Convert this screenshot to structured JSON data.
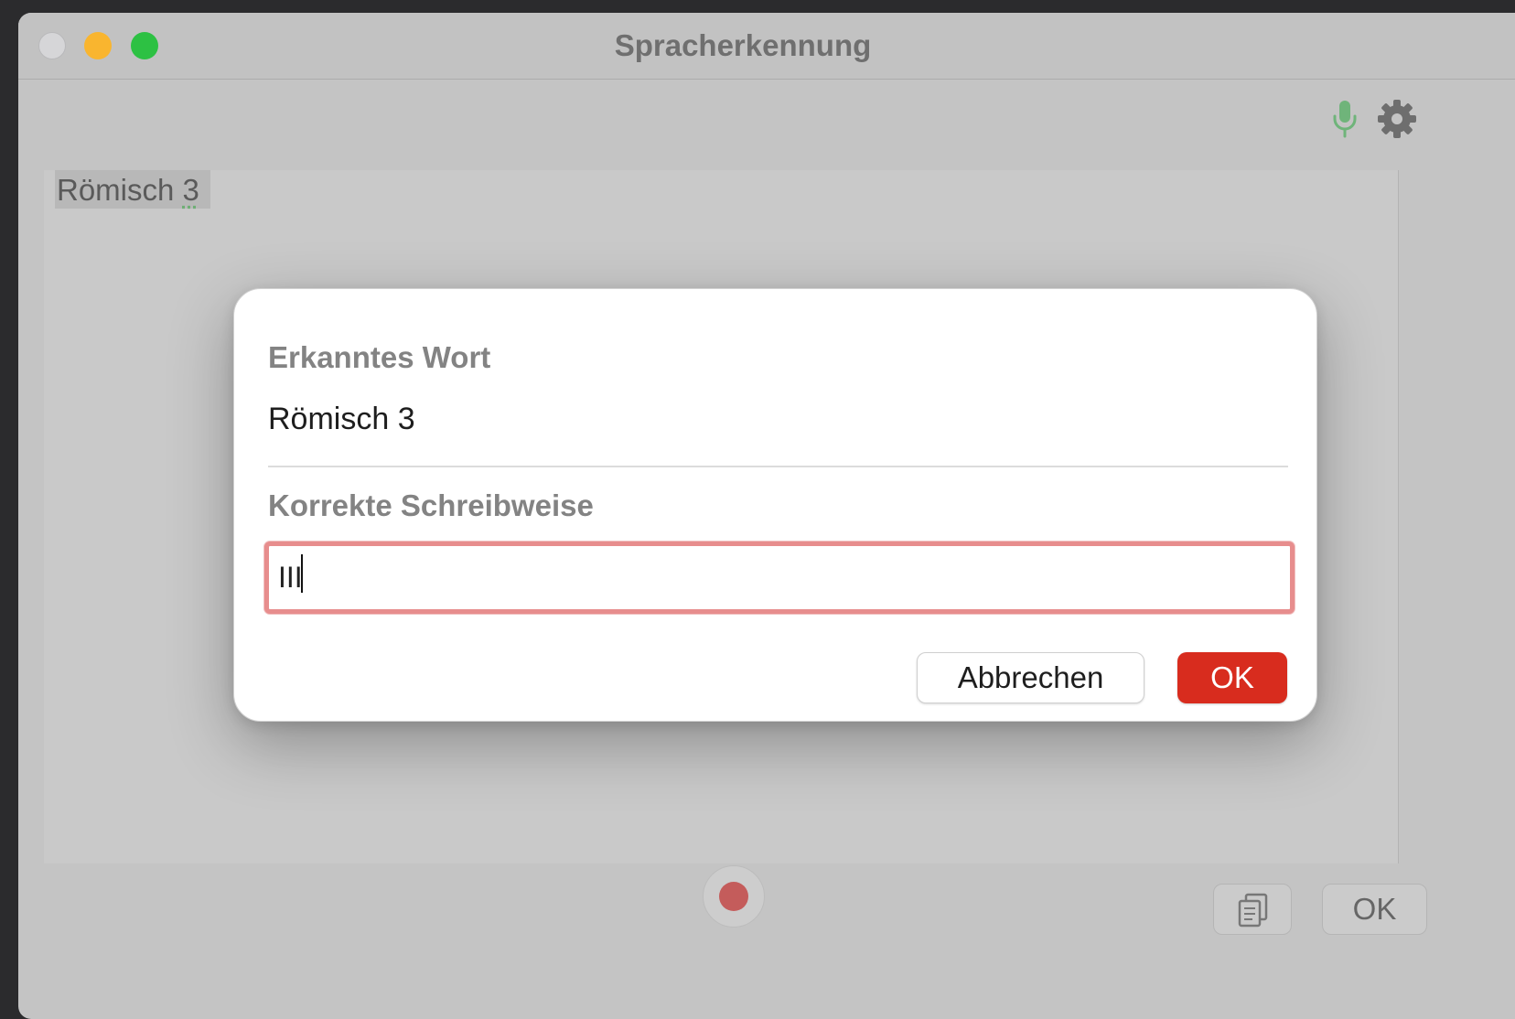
{
  "window": {
    "title": "Spracherkennung"
  },
  "toolbar": {
    "mic_icon": "microphone-icon",
    "settings_icon": "gear-icon",
    "mic_color": "#6fb47a"
  },
  "editor": {
    "text_main": "Römisch ",
    "text_underlined": "3"
  },
  "dialog": {
    "recognized_label": "Erkanntes Wort",
    "recognized_value": "Römisch 3",
    "correct_label": "Korrekte Schreibweise",
    "correct_value": "III",
    "cancel_label": "Abbrechen",
    "ok_label": "OK",
    "ok_color": "#d82c1e",
    "focus_ring_color": "#e78d8d"
  },
  "bottom_bar": {
    "record_icon": "record-icon",
    "copy_icon": "copy-icon",
    "ok_label": "OK"
  }
}
